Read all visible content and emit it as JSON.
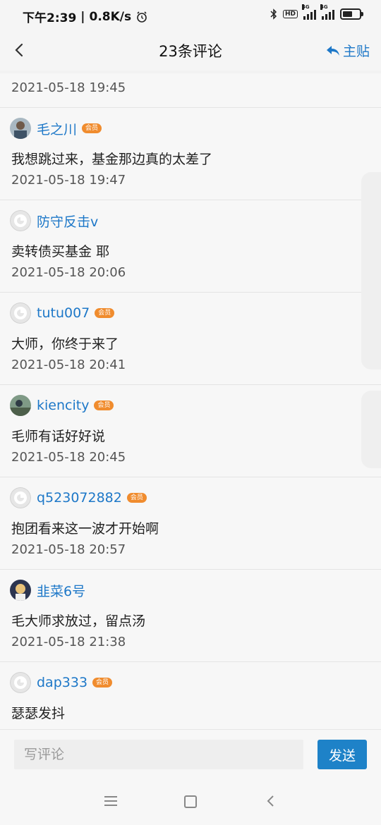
{
  "status_bar": {
    "time": "下午2:39",
    "speed": "0.8K/s",
    "net1": "4G",
    "net2": "4G",
    "hd": "HD"
  },
  "header": {
    "title": "23条评论",
    "main_post_label": "主贴"
  },
  "first_time": "2021-05-18 19:45",
  "comments": [
    {
      "user": "毛之川",
      "vip": "会员",
      "text": "我想跳过来，基金那边真的太差了",
      "time": "2021-05-18 19:47",
      "avatar": "photo"
    },
    {
      "user": "防守反击v",
      "vip": "",
      "text": "卖转债买基金 耶",
      "time": "2021-05-18 20:06",
      "avatar": "default"
    },
    {
      "user": "tutu007",
      "vip": "会员",
      "text": "大师，你终于来了",
      "time": "2021-05-18 20:41",
      "avatar": "default"
    },
    {
      "user": "kiencity",
      "vip": "会员",
      "text": "毛师有话好好说",
      "time": "2021-05-18 20:45",
      "avatar": "photo"
    },
    {
      "user": "q523072882",
      "vip": "会员",
      "text": "抱团看来这一波才开始啊",
      "time": "2021-05-18 20:57",
      "avatar": "default"
    },
    {
      "user": "韭菜6号",
      "vip": "",
      "text": "毛大师求放过，留点汤",
      "time": "2021-05-18 21:38",
      "avatar": "photo"
    },
    {
      "user": "dap333",
      "vip": "会员",
      "text": "瑟瑟发抖",
      "time": "",
      "avatar": "default"
    }
  ],
  "composer": {
    "placeholder": "写评论",
    "send_label": "发送"
  },
  "colors": {
    "link_blue": "#1e78c8",
    "vip_orange": "#f08c2e",
    "send_blue": "#1e82c8"
  }
}
